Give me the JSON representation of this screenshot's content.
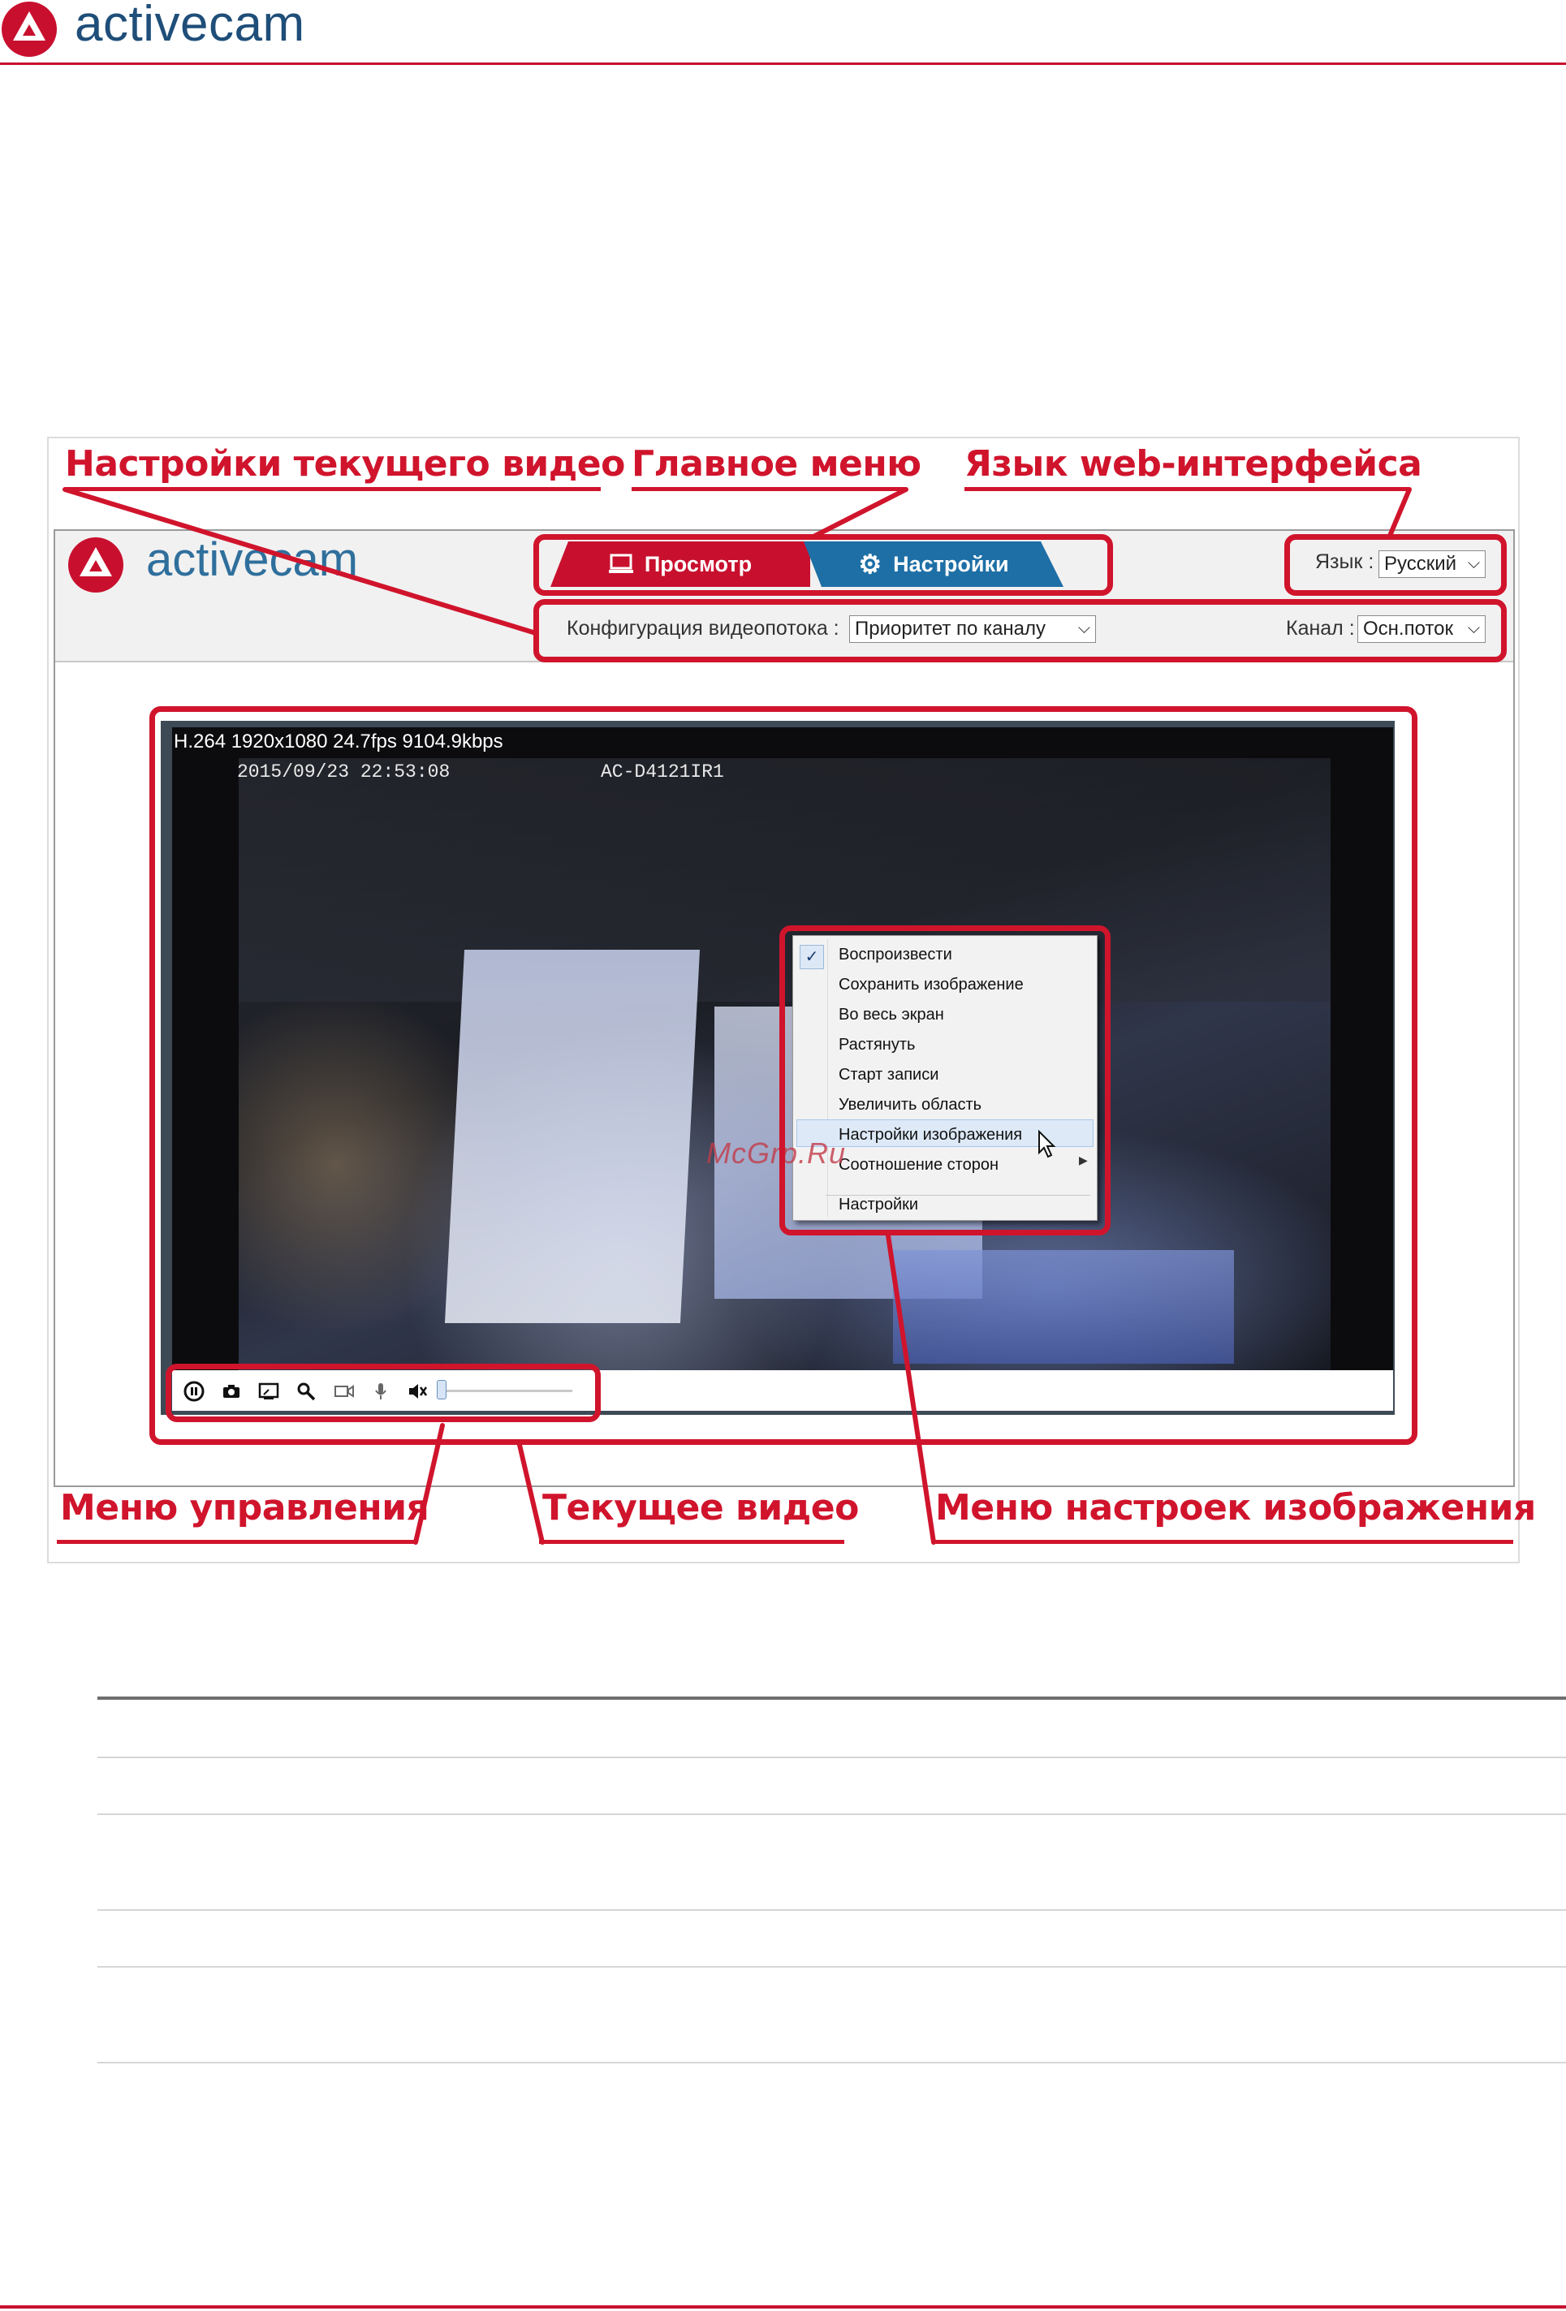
{
  "page_header": {
    "brand": "activecam"
  },
  "callouts": {
    "current_video_settings": "Настройки текущего видео",
    "main_menu": "Главное меню",
    "interface_language": "Язык web-интерфейса",
    "control_menu": "Меню управления",
    "current_video": "Текущее видео",
    "image_settings_menu": "Меню настроек изображения"
  },
  "web_ui": {
    "brand": "activecam",
    "tabs": [
      {
        "label": "Просмотр",
        "icon": "monitor-icon",
        "active": true
      },
      {
        "label": "Настройки",
        "icon": "gear-icon",
        "active": false
      }
    ],
    "language": {
      "label": "Язык :",
      "value": "Русский"
    },
    "stream_config": {
      "label": "Конфигурация видеопотока :",
      "value": "Приоритет по каналу"
    },
    "channel": {
      "label": "Канал :",
      "value": "Осн.поток"
    }
  },
  "video": {
    "stream_info": "H.264 1920x1080 24.7fps 9104.9kbps",
    "osd_datetime": "2015/09/23 22:53:08",
    "osd_camera": "AC-D4121IR1"
  },
  "context_menu": {
    "items": [
      {
        "label": "Воспроизвести",
        "checked": true
      },
      {
        "label": "Сохранить изображение"
      },
      {
        "label": "Во весь экран"
      },
      {
        "label": "Растянуть"
      },
      {
        "label": "Старт записи"
      },
      {
        "label": "Увеличить область"
      },
      {
        "label": "Настройки изображения",
        "highlighted": true
      },
      {
        "label": "Соотношение сторон",
        "has_submenu": true
      },
      {
        "label": "Настройки"
      }
    ]
  },
  "control_bar": {
    "icons": [
      "pause-icon",
      "camera-icon",
      "fullscreen-icon",
      "zoom-icon",
      "record-icon",
      "microphone-icon",
      "mute-icon"
    ],
    "volume_level": 0
  },
  "watermark": "McGrp.Ru",
  "colors": {
    "brand_red": "#c8102e",
    "callout_red": "#d0142c",
    "brand_blue": "#1f4e79",
    "tab_active": "#c8102e",
    "tab_inactive": "#1e6fa6"
  }
}
